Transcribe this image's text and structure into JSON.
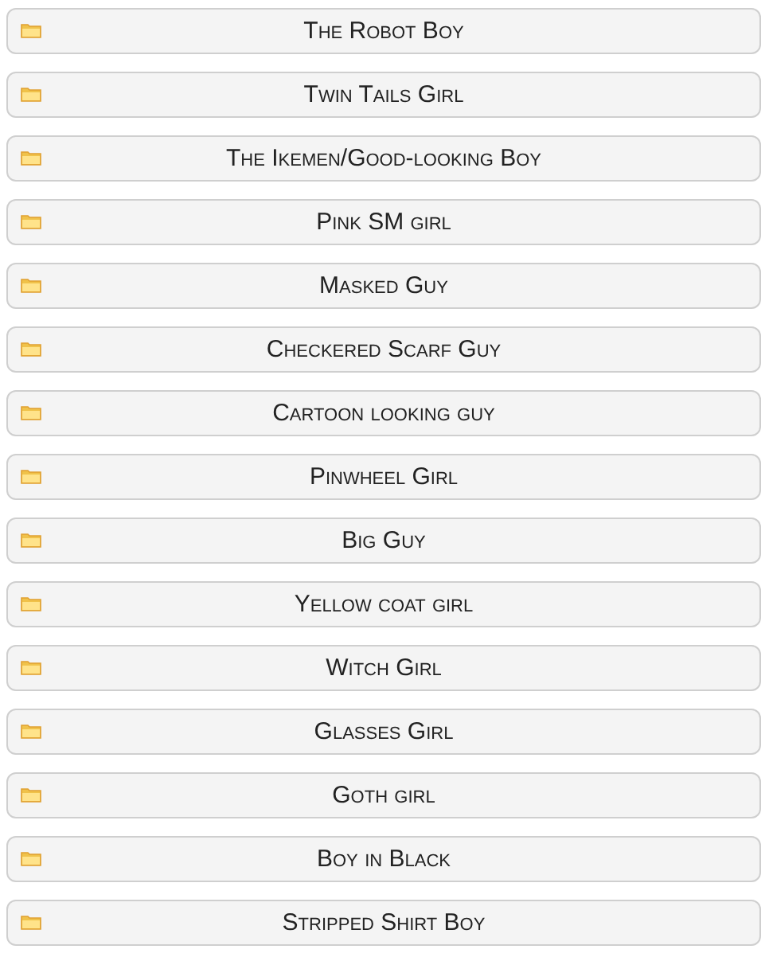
{
  "folders": [
    {
      "label": "The Robot Boy"
    },
    {
      "label": "Twin Tails Girl"
    },
    {
      "label": "The Ikemen/Good-looking Boy"
    },
    {
      "label": "Pink SM girl"
    },
    {
      "label": "Masked Guy"
    },
    {
      "label": "Checkered Scarf Guy"
    },
    {
      "label": "Cartoon looking guy"
    },
    {
      "label": "Pinwheel Girl"
    },
    {
      "label": "Big Guy"
    },
    {
      "label": "Yellow coat girl"
    },
    {
      "label": "Witch Girl"
    },
    {
      "label": "Glasses Girl"
    },
    {
      "label": "Goth girl"
    },
    {
      "label": "Boy in Black"
    },
    {
      "label": "Stripped Shirt Boy"
    }
  ]
}
